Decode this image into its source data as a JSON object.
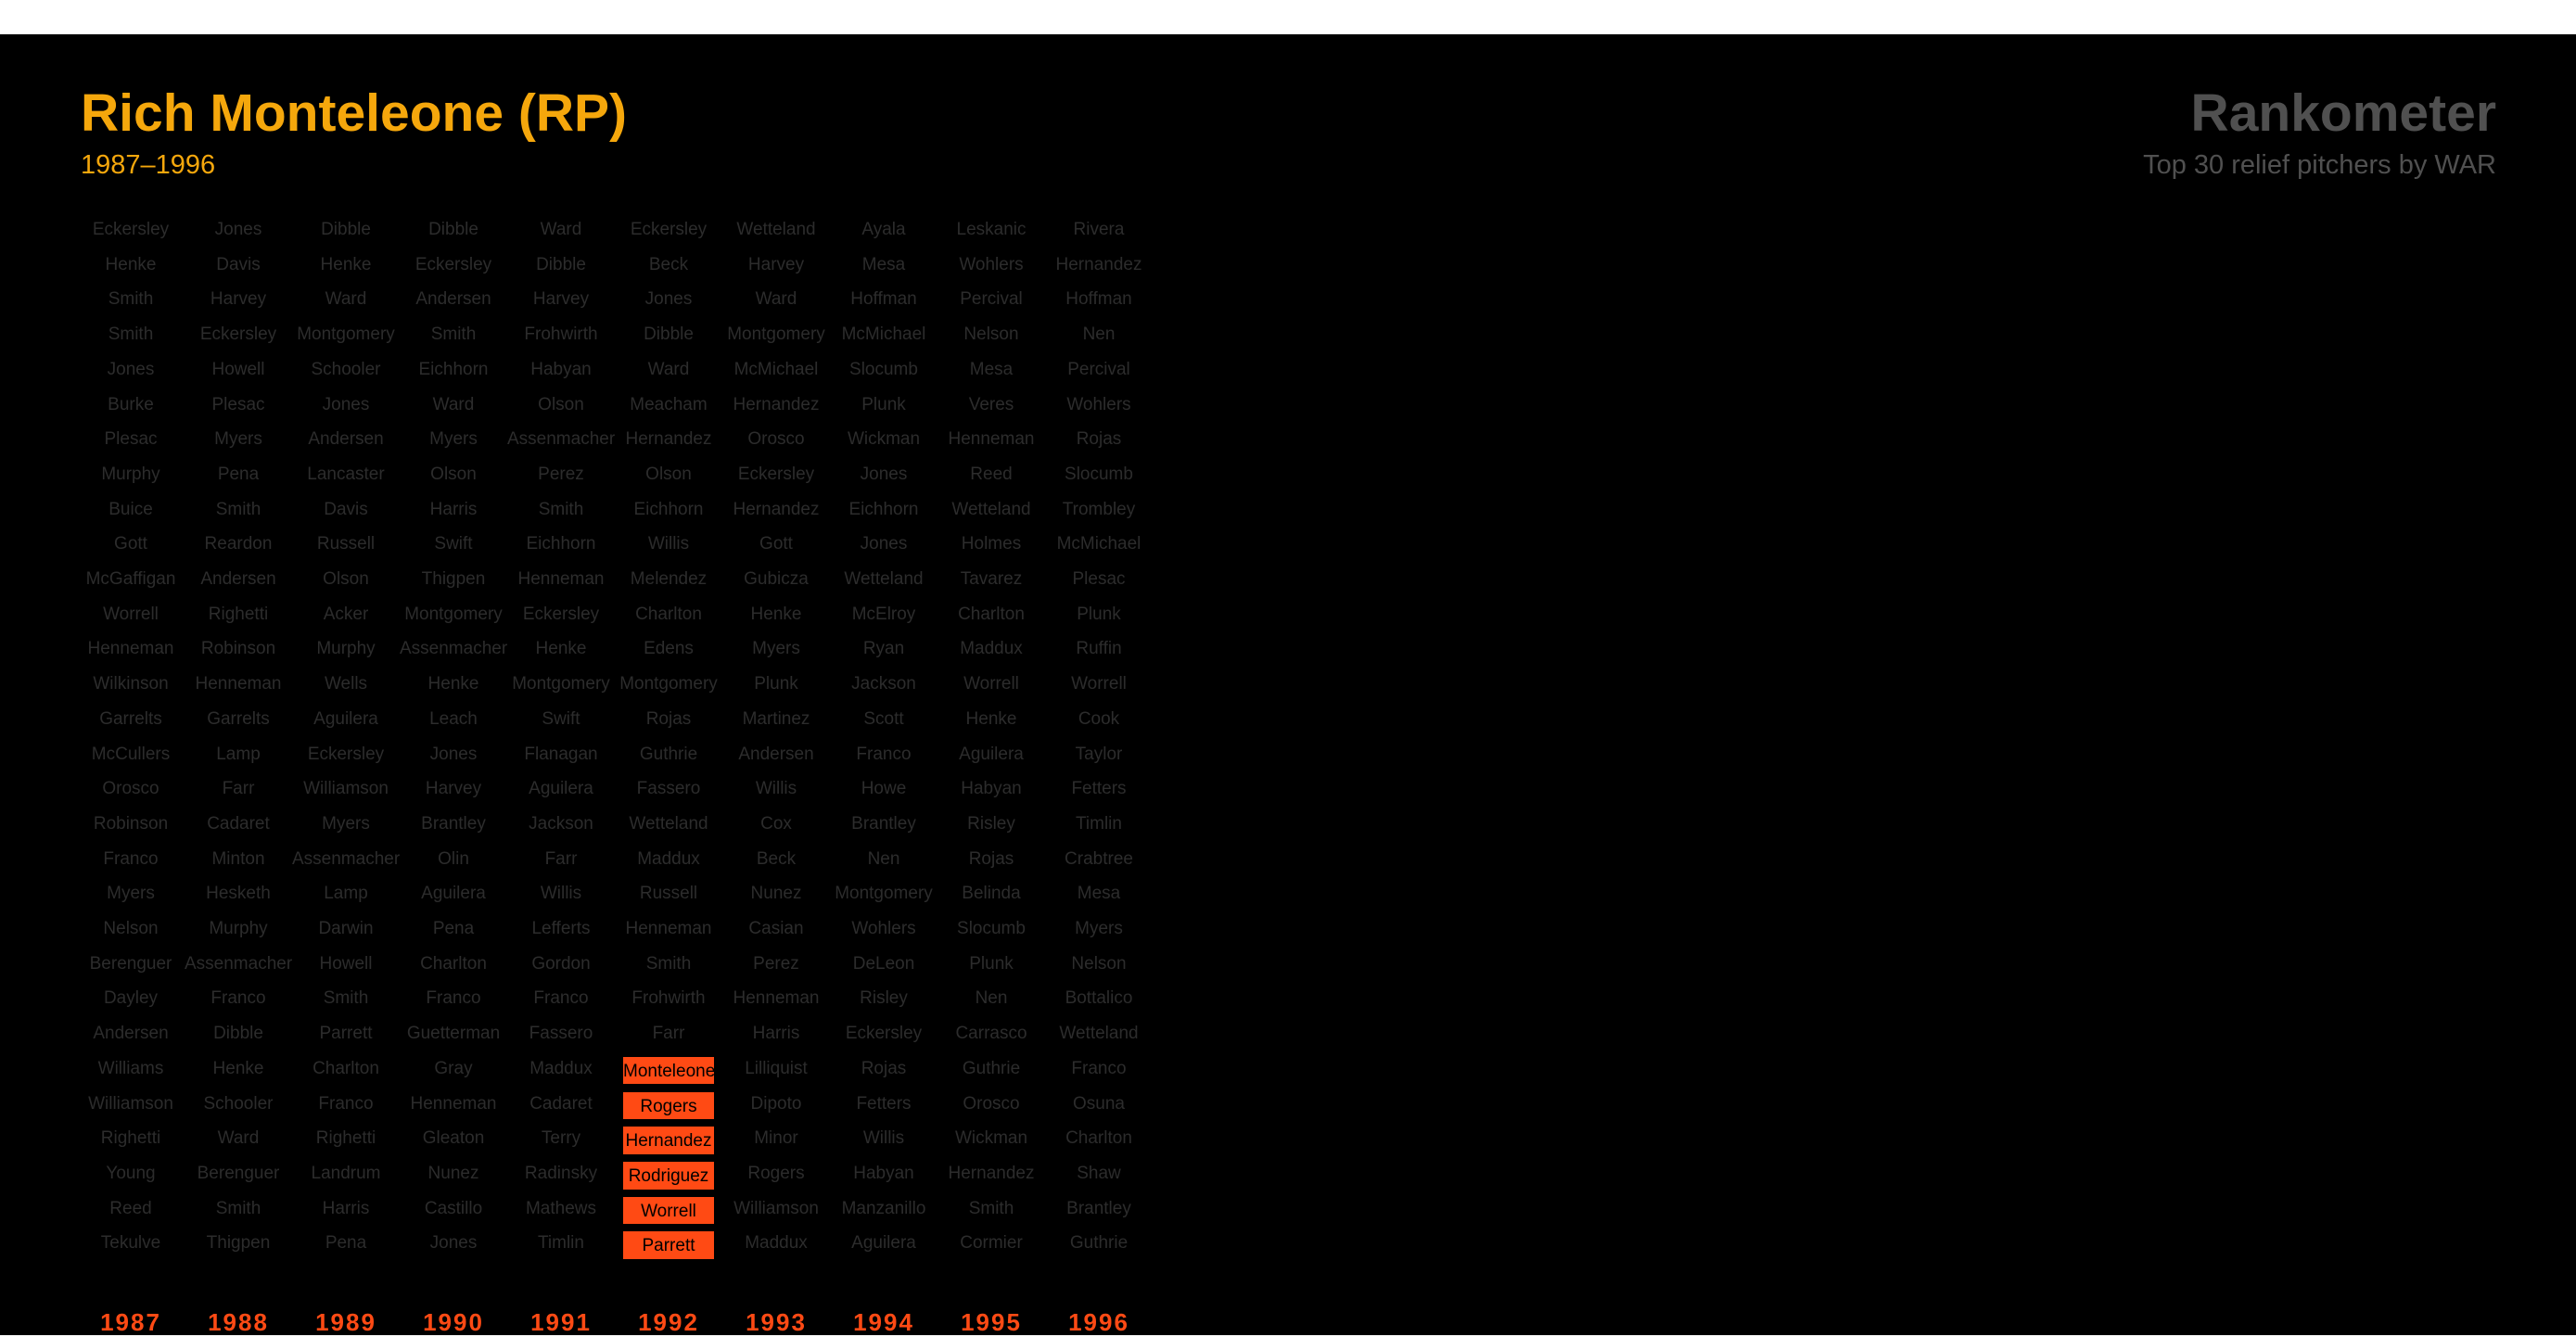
{
  "header": {
    "player": "Rich Monteleone (RP)",
    "years": "1987–1996",
    "brand": "Rankometer",
    "subtitle": "Top 30 relief pitchers by WAR"
  },
  "colors": {
    "background": "#000000",
    "title": "#f5a70c",
    "brand": "#505050",
    "name_text": "#2c2c2c",
    "highlight": "#ff4a14"
  },
  "columns": [
    {
      "year": "1987",
      "names": [
        "Eckersley",
        "Henke",
        "Smith",
        "Smith",
        "Jones",
        "Burke",
        "Plesac",
        "Murphy",
        "Buice",
        "Gott",
        "McGaffigan",
        "Worrell",
        "Henneman",
        "Wilkinson",
        "Garrelts",
        "McCullers",
        "Orosco",
        "Robinson",
        "Franco",
        "Myers",
        "Nelson",
        "Berenguer",
        "Dayley",
        "Andersen",
        "Williams",
        "Williamson",
        "Righetti",
        "Young",
        "Reed",
        "Tekulve"
      ],
      "highlight": []
    },
    {
      "year": "1988",
      "names": [
        "Jones",
        "Davis",
        "Harvey",
        "Eckersley",
        "Howell",
        "Plesac",
        "Myers",
        "Pena",
        "Smith",
        "Reardon",
        "Andersen",
        "Righetti",
        "Robinson",
        "Henneman",
        "Garrelts",
        "Lamp",
        "Farr",
        "Cadaret",
        "Minton",
        "Hesketh",
        "Murphy",
        "Assenmacher",
        "Franco",
        "Dibble",
        "Henke",
        "Schooler",
        "Ward",
        "Berenguer",
        "Smith",
        "Thigpen"
      ],
      "highlight": []
    },
    {
      "year": "1989",
      "names": [
        "Dibble",
        "Henke",
        "Ward",
        "Montgomery",
        "Schooler",
        "Jones",
        "Andersen",
        "Lancaster",
        "Davis",
        "Russell",
        "Olson",
        "Acker",
        "Murphy",
        "Wells",
        "Aguilera",
        "Eckersley",
        "Williamson",
        "Myers",
        "Assenmacher",
        "Lamp",
        "Darwin",
        "Howell",
        "Smith",
        "Parrett",
        "Charlton",
        "Franco",
        "Righetti",
        "Landrum",
        "Harris",
        "Pena"
      ],
      "highlight": []
    },
    {
      "year": "1990",
      "names": [
        "Dibble",
        "Eckersley",
        "Andersen",
        "Smith",
        "Eichhorn",
        "Ward",
        "Myers",
        "Olson",
        "Harris",
        "Swift",
        "Thigpen",
        "Montgomery",
        "Assenmacher",
        "Henke",
        "Leach",
        "Jones",
        "Harvey",
        "Brantley",
        "Olin",
        "Aguilera",
        "Pena",
        "Charlton",
        "Franco",
        "Guetterman",
        "Gray",
        "Henneman",
        "Gleaton",
        "Nunez",
        "Castillo",
        "Jones"
      ],
      "highlight": []
    },
    {
      "year": "1991",
      "names": [
        "Ward",
        "Dibble",
        "Harvey",
        "Frohwirth",
        "Habyan",
        "Olson",
        "Assenmacher",
        "Perez",
        "Smith",
        "Eichhorn",
        "Henneman",
        "Eckersley",
        "Henke",
        "Montgomery",
        "Swift",
        "Flanagan",
        "Aguilera",
        "Jackson",
        "Farr",
        "Willis",
        "Lefferts",
        "Gordon",
        "Franco",
        "Fassero",
        "Maddux",
        "Cadaret",
        "Terry",
        "Radinsky",
        "Mathews",
        "Timlin"
      ],
      "highlight": []
    },
    {
      "year": "1992",
      "names": [
        "Eckersley",
        "Beck",
        "Jones",
        "Dibble",
        "Ward",
        "Meacham",
        "Hernandez",
        "Olson",
        "Eichhorn",
        "Willis",
        "Melendez",
        "Charlton",
        "Edens",
        "Montgomery",
        "Rojas",
        "Guthrie",
        "Fassero",
        "Wetteland",
        "Maddux",
        "Russell",
        "Henneman",
        "Smith",
        "Frohwirth",
        "Farr",
        "Monteleone",
        "Rogers",
        "Hernandez",
        "Rodriguez",
        "Worrell",
        "Parrett"
      ],
      "highlight": [
        24,
        25,
        26,
        27,
        28,
        29
      ]
    },
    {
      "year": "1993",
      "names": [
        "Wetteland",
        "Harvey",
        "Ward",
        "Montgomery",
        "McMichael",
        "Hernandez",
        "Orosco",
        "Eckersley",
        "Hernandez",
        "Gott",
        "Gubicza",
        "Henke",
        "Myers",
        "Plunk",
        "Martinez",
        "Andersen",
        "Willis",
        "Cox",
        "Beck",
        "Nunez",
        "Casian",
        "Perez",
        "Henneman",
        "Harris",
        "Lilliquist",
        "Dipoto",
        "Minor",
        "Rogers",
        "Williamson",
        "Maddux"
      ],
      "highlight": []
    },
    {
      "year": "1994",
      "names": [
        "Ayala",
        "Mesa",
        "Hoffman",
        "McMichael",
        "Slocumb",
        "Plunk",
        "Wickman",
        "Jones",
        "Eichhorn",
        "Jones",
        "Wetteland",
        "McElroy",
        "Ryan",
        "Jackson",
        "Scott",
        "Franco",
        "Howe",
        "Brantley",
        "Nen",
        "Montgomery",
        "Wohlers",
        "DeLeon",
        "Risley",
        "Eckersley",
        "Rojas",
        "Fetters",
        "Willis",
        "Habyan",
        "Manzanillo",
        "Aguilera"
      ],
      "highlight": []
    },
    {
      "year": "1995",
      "names": [
        "Leskanic",
        "Wohlers",
        "Percival",
        "Nelson",
        "Mesa",
        "Veres",
        "Henneman",
        "Reed",
        "Wetteland",
        "Holmes",
        "Tavarez",
        "Charlton",
        "Maddux",
        "Worrell",
        "Henke",
        "Aguilera",
        "Habyan",
        "Risley",
        "Rojas",
        "Belinda",
        "Slocumb",
        "Plunk",
        "Nen",
        "Carrasco",
        "Guthrie",
        "Orosco",
        "Wickman",
        "Hernandez",
        "Smith",
        "Cormier"
      ],
      "highlight": []
    },
    {
      "year": "1996",
      "names": [
        "Rivera",
        "Hernandez",
        "Hoffman",
        "Nen",
        "Percival",
        "Wohlers",
        "Rojas",
        "Slocumb",
        "Trombley",
        "McMichael",
        "Plesac",
        "Plunk",
        "Ruffin",
        "Worrell",
        "Cook",
        "Taylor",
        "Fetters",
        "Timlin",
        "Crabtree",
        "Mesa",
        "Myers",
        "Nelson",
        "Bottalico",
        "Wetteland",
        "Franco",
        "Osuna",
        "Charlton",
        "Shaw",
        "Brantley",
        "Guthrie"
      ],
      "highlight": []
    }
  ]
}
